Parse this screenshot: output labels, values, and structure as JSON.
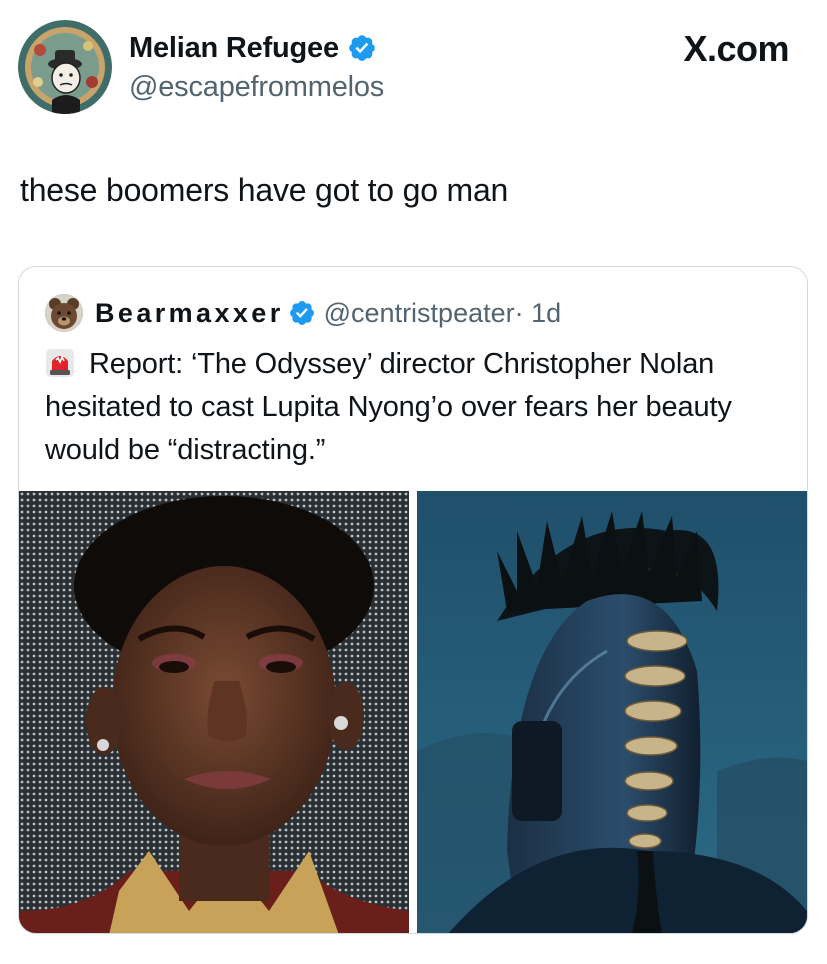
{
  "author": {
    "display_name": "Melian Refugee",
    "handle": "@escapefrommelos",
    "avatar_icon": "avatar-icon",
    "verified": true
  },
  "brand": {
    "label": "X.com"
  },
  "tweet": {
    "text": "these boomers have got to go man"
  },
  "quoted": {
    "display_name": "Bearmaxxer",
    "handle": "@centristpeater",
    "time": "· 1d",
    "verified": true,
    "emoji_icon": "siren-icon",
    "text": "Report: ‘The Odyssey’ director Christopher Nolan hesitated to cast Lupita Nyong’o over fears her beauty would be “distracting.”",
    "images": [
      {
        "name": "portrait-photo"
      },
      {
        "name": "helmet-photo"
      }
    ]
  },
  "colors": {
    "verified_blue": "#1d9bf0",
    "text": "#0f1419",
    "secondary": "#536471",
    "border": "#cfd9de"
  }
}
